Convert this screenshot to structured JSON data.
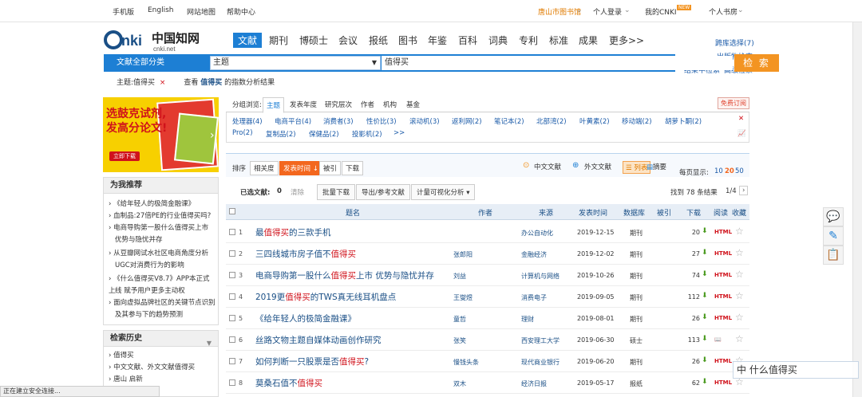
{
  "topbar": {
    "mobile": "手机版",
    "english": "English",
    "sitemap": "网站地图",
    "help": "帮助中心",
    "library": "唐山市图书馆",
    "login": "个人登录",
    "mycnki": "我的CNKI",
    "new_badge": "NEW",
    "bookshelf": "个人书房"
  },
  "logo": {
    "text": "CNKI中国知网",
    "sub": "cnki.net"
  },
  "nav": [
    "文献",
    "期刊",
    "博硕士",
    "会议",
    "报纸",
    "图书",
    "年鉴",
    "百科",
    "词典",
    "专利",
    "标准",
    "成果",
    "更多>>"
  ],
  "right_links": {
    "cross_db": "跨库选择(7)",
    "pub_search": "出版物检索",
    "in_results": "结果中检索",
    "advanced": "高级检索"
  },
  "search": {
    "category": "文献全部分类",
    "field": "主题",
    "query": "值得买",
    "button": "检 索"
  },
  "crumbs": {
    "topic": "主题:值得买",
    "close": "×",
    "view_prefix": "查看",
    "keyword": "值得买",
    "view_suffix": "的指数分析结果"
  },
  "ad": {
    "line1": "选鼓克试剂,",
    "line2": "发高分论文!",
    "read": "立即下载"
  },
  "recommend": {
    "title": "为我推荐",
    "items": [
      "《给年轻人的极简金融课》",
      "血制品:27倍PE的行业值得买吗?",
      "电商导购第一股什么值得买上市",
      "优势与隐忧并存",
      "从豆瓣网试水社区电商角度分析",
      "UGC对消费行为的影响",
      "《什么值得买V8.7》APP本正式上",
      "线 赋予用户更多主动权",
      "面向虚拟品牌社区的关键节点识别",
      "及其参与下的趋势预测"
    ]
  },
  "history": {
    "title": "检索历史",
    "items": [
      "值得买",
      "中文文献、外文文献值得买",
      "唐山 启新"
    ]
  },
  "group_tabs": {
    "label": "分组浏览:",
    "tabs": [
      "主题",
      "发表年度",
      "研究层次",
      "作者",
      "机构",
      "基金"
    ],
    "subscribe": "免费订阅"
  },
  "group_items": [
    "处理器(4)",
    "电商平台(4)",
    "消费者(3)",
    "性价比(3)",
    "滚动机(3)",
    "返利网(2)",
    "笔记本(2)",
    "北部湾(2)",
    "叶黄素(2)",
    "移动端(2)",
    "胡萝卜酮(2)",
    "Pro(2)",
    "复制品(2)",
    "保健品(2)",
    "投影机(2)",
    ">>"
  ],
  "sort": {
    "label": "排序",
    "options": [
      "相关度",
      "发表时间",
      "被引",
      "下载"
    ],
    "active": "发表时间",
    "chinese": "中文文献",
    "foreign": "外文文献",
    "list": "列表",
    "abstract": "摘要",
    "perpage_label": "每页显示:",
    "perpage": [
      "10",
      "20",
      "50"
    ]
  },
  "toolbar": {
    "selected_label": "已选文献:",
    "selected_count": "0",
    "clear": "清除",
    "batch": "批量下载",
    "export": "导出/参考文献",
    "visual": "计量可视化分析",
    "found": "找到 78 条结果",
    "page": "1/4"
  },
  "table": {
    "headers": [
      "题名",
      "作者",
      "来源",
      "发表时间",
      "数据库",
      "被引",
      "下载",
      "阅读",
      "收藏"
    ],
    "rows": [
      {
        "no": "1",
        "pre": "最",
        "hl": "值得买",
        "post": "的三款手机",
        "author": "",
        "source": "办公自动化",
        "date": "2019-12-15",
        "db": "期刊",
        "dl": "20"
      },
      {
        "no": "2",
        "pre": "三四线城市房子值不",
        "hl": "值得买",
        "post": "",
        "author": "张郎阳",
        "source": "金融经济",
        "date": "2019-12-02",
        "db": "期刊",
        "dl": "27"
      },
      {
        "no": "3",
        "pre": "电商导购第一股什么",
        "hl": "值得买",
        "post": "上市 优势与隐忧并存",
        "author": "刘益",
        "source": "计算机与网络",
        "date": "2019-10-26",
        "db": "期刊",
        "dl": "74"
      },
      {
        "no": "4",
        "pre": "2019更",
        "hl": "值得买",
        "post": "的TWS真无线耳机盘点",
        "author": "王燮煜",
        "source": "消费电子",
        "date": "2019-09-05",
        "db": "期刊",
        "dl": "112"
      },
      {
        "no": "5",
        "pre": "《给年轻人的极简金融课》",
        "hl": "",
        "post": "",
        "author": "童哲",
        "source": "理财",
        "date": "2019-08-01",
        "db": "期刊",
        "dl": "26"
      },
      {
        "no": "6",
        "pre": "丝路文物主题自媒体动画创作研究",
        "hl": "",
        "post": "",
        "author": "张笑",
        "source": "西安理工大学",
        "date": "2019-06-30",
        "db": "硕士",
        "dl": "113"
      },
      {
        "no": "7",
        "pre": "如何判断一只股票是否",
        "hl": "值得买",
        "post": "?",
        "author": "慢钱头条",
        "source": "现代商业银行",
        "date": "2019-06-20",
        "db": "期刊",
        "dl": "26"
      },
      {
        "no": "8",
        "pre": "莫桑石值不",
        "hl": "值得买",
        "post": "",
        "author": "双木",
        "source": "经济日报",
        "date": "2019-05-17",
        "db": "报纸",
        "dl": "62"
      }
    ]
  },
  "status": "正在建立安全连接...",
  "watermark": "中 什么值得买"
}
